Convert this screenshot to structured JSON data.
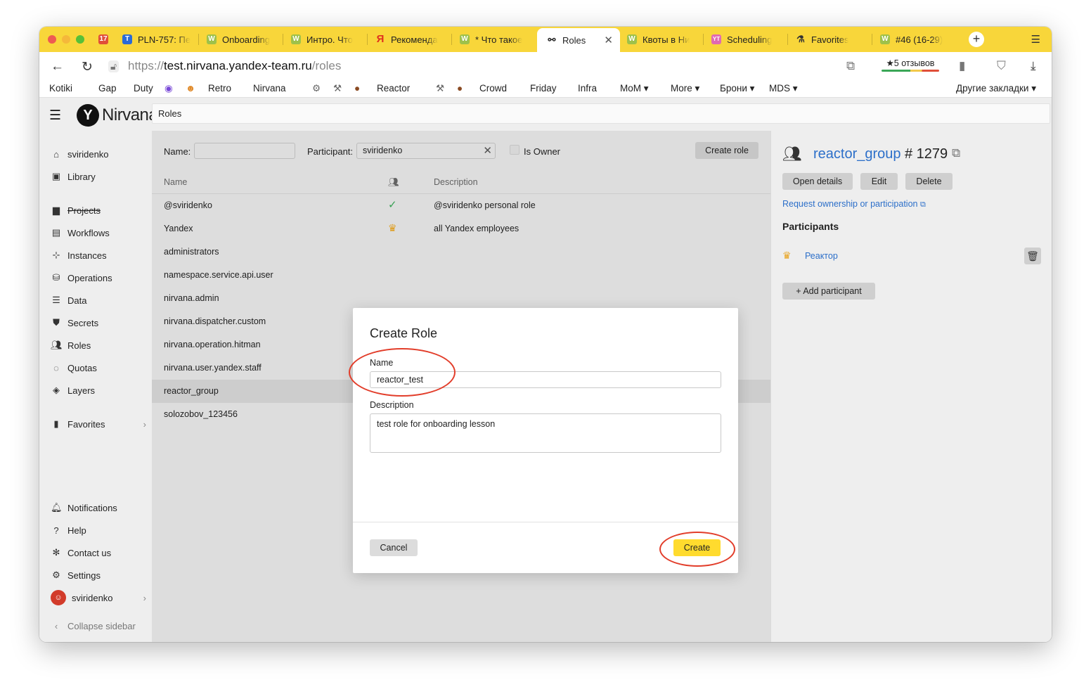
{
  "browser": {
    "tabs": [
      {
        "label": "17",
        "kind": "calendar"
      },
      {
        "label": "PLN-757: Пе",
        "kind": "tracker"
      },
      {
        "label": "Onboarding",
        "kind": "wiki"
      },
      {
        "label": "Интро. Что",
        "kind": "wiki"
      },
      {
        "label": "Рекоменда",
        "kind": "yandex"
      },
      {
        "label": "* Что такое",
        "kind": "wiki"
      },
      {
        "label": "Roles",
        "kind": "nirvana",
        "active": true
      },
      {
        "label": "Квоты в Ни",
        "kind": "wiki"
      },
      {
        "label": "Scheduling",
        "kind": "yt"
      },
      {
        "label": "Favorites",
        "kind": "flask"
      },
      {
        "label": "#46 (16-29)",
        "kind": "wiki"
      }
    ],
    "url_scheme": "https://",
    "url_host": "test.nirvana.yandex-team.ru",
    "url_path": "/roles",
    "reviews": "★5 отзывов",
    "bookmarks": [
      "Kotiki",
      "Gap",
      "Duty",
      "Retro",
      "Nirvana",
      "Reactor",
      "Crowd",
      "Friday",
      "Infra",
      "MoM ▾",
      "More ▾",
      "Брони ▾",
      "MDS ▾",
      "Другие закладки ▾"
    ]
  },
  "sidebar": {
    "logo": "Nirvana",
    "top_items": [
      {
        "label": "sviridenko"
      },
      {
        "label": "Library"
      }
    ],
    "items": [
      {
        "label": "Projects"
      },
      {
        "label": "Workflows"
      },
      {
        "label": "Instances"
      },
      {
        "label": "Operations"
      },
      {
        "label": "Data"
      },
      {
        "label": "Secrets"
      },
      {
        "label": "Roles"
      },
      {
        "label": "Quotas"
      },
      {
        "label": "Layers"
      }
    ],
    "favorites": "Favorites",
    "bottom_items": [
      {
        "label": "Notifications"
      },
      {
        "label": "Help"
      },
      {
        "label": "Contact us"
      },
      {
        "label": "Settings"
      },
      {
        "label": "sviridenko"
      }
    ],
    "collapse": "Collapse sidebar"
  },
  "breadcrumb": "Roles",
  "filters": {
    "name_label": "Name:",
    "name_value": "",
    "participant_label": "Participant:",
    "participant_value": "sviridenko",
    "is_owner_label": "Is Owner",
    "create_role": "Create role"
  },
  "table": {
    "headers": [
      "Name",
      "",
      "Description"
    ],
    "rows": [
      {
        "name": "@sviridenko",
        "mark": "check",
        "description": "@sviridenko personal role"
      },
      {
        "name": "Yandex",
        "mark": "crown",
        "description": "all Yandex employees"
      },
      {
        "name": "administrators",
        "mark": "",
        "description": ""
      },
      {
        "name": "namespace.service.api.user",
        "mark": "",
        "description": ""
      },
      {
        "name": "nirvana.admin",
        "mark": "",
        "description": ""
      },
      {
        "name": "nirvana.dispatcher.custom",
        "mark": "",
        "description": ""
      },
      {
        "name": "nirvana.operation.hitman",
        "mark": "",
        "description": ""
      },
      {
        "name": "nirvana.user.yandex.staff",
        "mark": "",
        "description": ""
      },
      {
        "name": "reactor_group",
        "mark": "",
        "description": "",
        "selected": true
      },
      {
        "name": "solozobov_123456",
        "mark": "",
        "description": ""
      }
    ]
  },
  "details": {
    "title": "reactor_group",
    "id": "# 1279",
    "open_details": "Open details",
    "edit": "Edit",
    "delete": "Delete",
    "request_link": "Request ownership or participation",
    "participants_heading": "Participants",
    "participants": [
      {
        "name": "Реактор"
      }
    ],
    "add_participant": "+ Add participant"
  },
  "modal": {
    "title": "Create Role",
    "name_label": "Name",
    "name_value": "reactor_test",
    "description_label": "Description",
    "description_value": "test role for onboarding lesson",
    "cancel": "Cancel",
    "create": "Create"
  },
  "colors": {
    "tabbar": "#f8d63a",
    "link": "#2c6fc9",
    "accent_button": "#ffdb2e",
    "annotation": "#e23d2a",
    "check": "#3aa757",
    "crown": "#e8a21a"
  }
}
